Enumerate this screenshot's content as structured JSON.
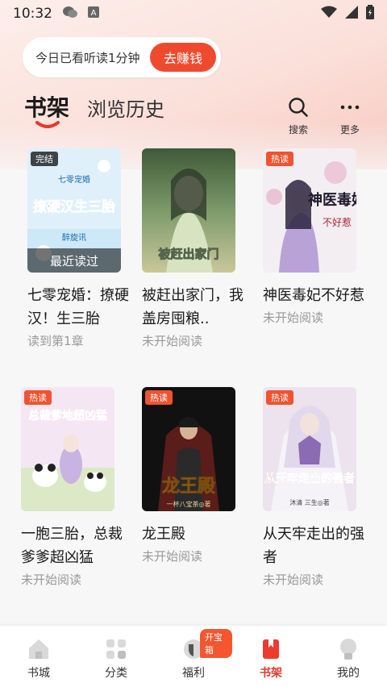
{
  "status": {
    "time": "10:32"
  },
  "banner": {
    "text": "今日已看听读1分钟",
    "button": "去赚钱"
  },
  "tabs": {
    "shelf": "书架",
    "history": "浏览历史"
  },
  "tools": {
    "search": "搜索",
    "more": "更多"
  },
  "books": [
    {
      "title": "七零宠婚：撩硬汉！生三胎",
      "sub": "读到第1章",
      "badge": "完结",
      "overlay": "最近读过",
      "cover_title": "撩硬汉生三胎",
      "cover_top": "七零宠婚",
      "cover_author": "醉旋讯"
    },
    {
      "title": "被赶出家门，我盖房囤粮..",
      "sub": "未开始阅读",
      "badge": "",
      "cover_title": "被赶出家门",
      "cover_top": "",
      "cover_author": ""
    },
    {
      "title": "神医毒妃不好惹",
      "sub": "未开始阅读",
      "badge": "热读",
      "cover_title": "神医毒妃",
      "cover_top": "不好惹",
      "cover_author": ""
    },
    {
      "title": "一胞三胎，总裁爹爹超凶猛",
      "sub": "未开始阅读",
      "badge": "热读",
      "cover_title": "总裁爹地超凶猛",
      "cover_top": "",
      "cover_author": ""
    },
    {
      "title": "龙王殿",
      "sub": "未开始阅读",
      "badge": "热读",
      "cover_title": "龙王殿",
      "cover_top": "",
      "cover_author": "一杯八宝茶◎著"
    },
    {
      "title": "从天牢走出的强者",
      "sub": "未开始阅读",
      "badge": "热读",
      "cover_title": "从天牢走出的强者",
      "cover_top": "",
      "cover_author": "沐清 三生◎著"
    }
  ],
  "nav": {
    "items": [
      "书城",
      "分类",
      "福利",
      "书架",
      "我的"
    ],
    "treasure": "开宝箱"
  },
  "colors": {
    "accent": "#e6392a",
    "button": "#f04a2e"
  }
}
